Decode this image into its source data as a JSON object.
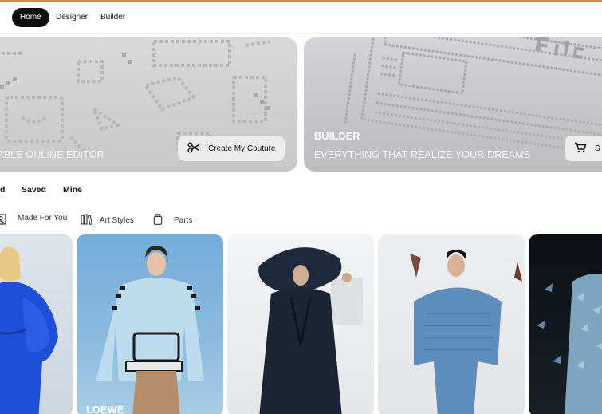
{
  "nav": {
    "tabs": [
      {
        "label": "Home",
        "active": true
      },
      {
        "label": "Designer",
        "active": false
      },
      {
        "label": "Builder",
        "active": false
      }
    ],
    "accent_color": "#e8833a"
  },
  "banners": [
    {
      "title": "",
      "subtitle": "SABLE ONLINE EDITOR",
      "button_label": "Create My Couture",
      "button_icon": "scissors-icon"
    },
    {
      "title": "BUILDER",
      "subtitle": "EVERYTHING  THAT REALIZE YOUR DREAMS",
      "button_label": "S",
      "button_icon": "cart-icon"
    }
  ],
  "subtabs": [
    "d",
    "Saved",
    "Mine"
  ],
  "filters": [
    {
      "label": "",
      "icon": "portrait-icon"
    },
    {
      "label": "Made For You",
      "icon": "portrait-icon"
    },
    {
      "label": "Art Styles",
      "icon": "books-icon"
    },
    {
      "label": "Parts",
      "icon": "jar-icon"
    }
  ],
  "cards": [
    {
      "label": "",
      "colors": [
        "#1f4fd6",
        "#c9d2de"
      ]
    },
    {
      "label": "LOEWE",
      "colors": [
        "#6aa6d8",
        "#9fc5e0"
      ]
    },
    {
      "label": "",
      "colors": [
        "#1b2533",
        "#e8eaec"
      ]
    },
    {
      "label": "",
      "colors": [
        "#5d8dbb",
        "#e5e7ea"
      ]
    },
    {
      "label": "",
      "colors": [
        "#0a0d12",
        "#8fb3cc"
      ]
    }
  ]
}
